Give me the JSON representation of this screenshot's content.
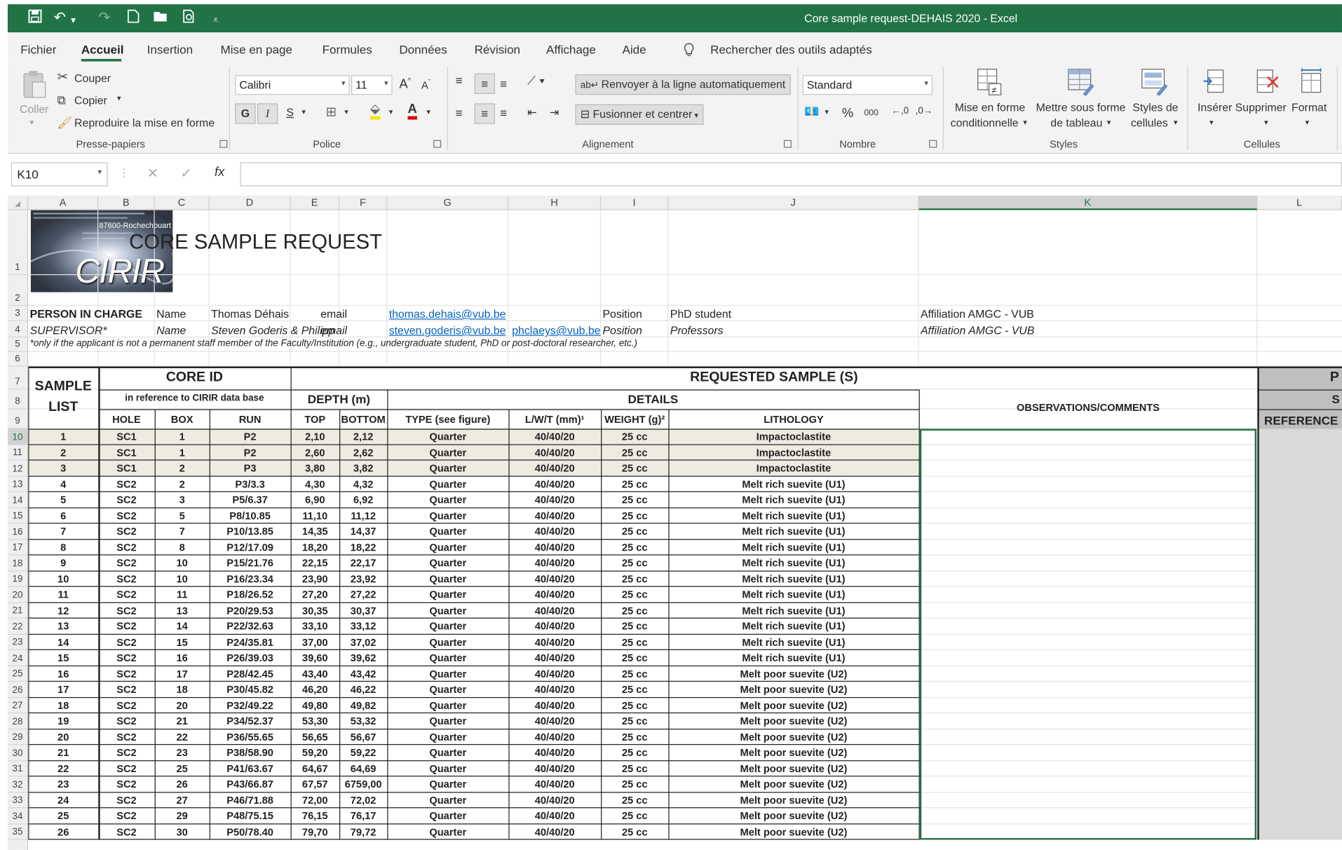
{
  "window": {
    "title": "Core sample request-DEHAIS 2020  -  Excel"
  },
  "quick_access": [
    "save-icon",
    "undo-icon",
    "redo-icon",
    "new-icon",
    "open-icon",
    "print-preview-icon",
    "customize-icon"
  ],
  "menu": [
    "Fichier",
    "Accueil",
    "Insertion",
    "Mise en page",
    "Formules",
    "Données",
    "Révision",
    "Affichage",
    "Aide"
  ],
  "tell_me": "Rechercher des outils adaptés",
  "ribbon": {
    "clipboard": {
      "paste": "Coller",
      "cut": "Couper",
      "copy": "Copier",
      "format_painter": "Reproduire la mise en forme",
      "group": "Presse-papiers"
    },
    "font": {
      "name": "Calibri",
      "size": "11",
      "bold": "G",
      "italic": "I",
      "underline": "S",
      "group": "Police"
    },
    "alignment": {
      "wrap": "Renvoyer à la ligne automatiquement",
      "merge": "Fusionner et centrer",
      "group": "Alignement"
    },
    "number": {
      "format": "Standard",
      "group": "Nombre",
      "percent": "%",
      "thousands": "000"
    },
    "styles": {
      "conditional_1": "Mise en forme",
      "conditional_2": "conditionnelle",
      "table_1": "Mettre sous forme",
      "table_2": "de tableau",
      "cell_1": "Styles de",
      "cell_2": "cellules",
      "group": "Styles"
    },
    "cells": {
      "insert": "Insérer",
      "delete": "Supprimer",
      "format": "Format",
      "group": "Cellules"
    }
  },
  "formula_bar": {
    "name_box": "K10",
    "formula": "",
    "fx": "fx"
  },
  "columns": [
    "A",
    "B",
    "C",
    "D",
    "E",
    "F",
    "G",
    "H",
    "I",
    "J",
    "K",
    "L"
  ],
  "rows": [
    "1",
    "2",
    "3",
    "4",
    "5",
    "6",
    "7",
    "8",
    "9",
    "10",
    "11",
    "12",
    "13",
    "14",
    "15",
    "16",
    "17",
    "18",
    "19",
    "20",
    "21",
    "22",
    "23",
    "24",
    "25",
    "26",
    "27",
    "28",
    "29",
    "30",
    "31",
    "32",
    "33",
    "34",
    "35"
  ],
  "logo": {
    "line1": "87600-Rochechouart",
    "text": "CIRIR"
  },
  "sheet": {
    "title": "CORE SAMPLE REQUEST",
    "person": {
      "label": "PERSON IN CHARGE",
      "name_label": "Name",
      "name": "Thomas Déhais",
      "email_label": "email",
      "email": "thomas.dehais@vub.be",
      "position_label": "Position",
      "position": "PhD student",
      "affiliation": "Affiliation AMGC - VUB"
    },
    "supervisor": {
      "label": "SUPERVISOR*",
      "name_label": "Name",
      "name": "Steven Goderis & Philipp",
      "email_label": "email",
      "email1": "steven.goderis@vub.be",
      "email2": "phclaeys@vub.be",
      "position_label": "Position",
      "position": "Professors",
      "affiliation": "Affiliation AMGC - VUB"
    },
    "footnote": "*only if the applicant is not a permanent staff member of the Faculty/Institution (e.g., undergraduate student, PhD or post-doctoral researcher, etc.)",
    "headers": {
      "sample_list_1": "SAMPLE",
      "sample_list_2": "LIST",
      "core_id": "CORE ID",
      "core_ref": "in reference to CIRIR data base",
      "requested": "REQUESTED SAMPLE (S)",
      "depth": "DEPTH (m)",
      "details": "DETAILS",
      "observations": "OBSERVATIONS/COMMENTS",
      "hole": "HOLE",
      "box": "BOX",
      "run": "RUN",
      "top": "TOP",
      "bottom": "BOTTOM",
      "type": "TYPE (see figure)",
      "lwt": "L/W/T (mm)¹",
      "weight": "WEIGHT (g)²",
      "lithology": "LITHOLOGY",
      "l_p": "P",
      "l_s": "S",
      "reference": "REFERENCE"
    },
    "samples": [
      [
        "1",
        "SC1",
        "1",
        "P2",
        "2,10",
        "2,12",
        "Quarter",
        "40/40/20",
        "25 cc",
        "Impactoclastite"
      ],
      [
        "2",
        "SC1",
        "1",
        "P2",
        "2,60",
        "2,62",
        "Quarter",
        "40/40/20",
        "25 cc",
        "Impactoclastite"
      ],
      [
        "3",
        "SC1",
        "2",
        "P3",
        "3,80",
        "3,82",
        "Quarter",
        "40/40/20",
        "25 cc",
        "Impactoclastite"
      ],
      [
        "4",
        "SC2",
        "2",
        "P3/3.3",
        "4,30",
        "4,32",
        "Quarter",
        "40/40/20",
        "25 cc",
        "Melt rich suevite (U1)"
      ],
      [
        "5",
        "SC2",
        "3",
        "P5/6.37",
        "6,90",
        "6,92",
        "Quarter",
        "40/40/20",
        "25 cc",
        "Melt rich suevite (U1)"
      ],
      [
        "6",
        "SC2",
        "5",
        "P8/10.85",
        "11,10",
        "11,12",
        "Quarter",
        "40/40/20",
        "25 cc",
        "Melt rich suevite (U1)"
      ],
      [
        "7",
        "SC2",
        "7",
        "P10/13.85",
        "14,35",
        "14,37",
        "Quarter",
        "40/40/20",
        "25 cc",
        "Melt rich suevite (U1)"
      ],
      [
        "8",
        "SC2",
        "8",
        "P12/17.09",
        "18,20",
        "18,22",
        "Quarter",
        "40/40/20",
        "25 cc",
        "Melt rich suevite (U1)"
      ],
      [
        "9",
        "SC2",
        "10",
        "P15/21.76",
        "22,15",
        "22,17",
        "Quarter",
        "40/40/20",
        "25 cc",
        "Melt rich suevite (U1)"
      ],
      [
        "10",
        "SC2",
        "10",
        "P16/23.34",
        "23,90",
        "23,92",
        "Quarter",
        "40/40/20",
        "25 cc",
        "Melt rich suevite (U1)"
      ],
      [
        "11",
        "SC2",
        "11",
        "P18/26.52",
        "27,20",
        "27,22",
        "Quarter",
        "40/40/20",
        "25 cc",
        "Melt rich suevite (U1)"
      ],
      [
        "12",
        "SC2",
        "13",
        "P20/29.53",
        "30,35",
        "30,37",
        "Quarter",
        "40/40/20",
        "25 cc",
        "Melt rich suevite (U1)"
      ],
      [
        "13",
        "SC2",
        "14",
        "P22/32.63",
        "33,10",
        "33,12",
        "Quarter",
        "40/40/20",
        "25 cc",
        "Melt rich suevite (U1)"
      ],
      [
        "14",
        "SC2",
        "15",
        "P24/35.81",
        "37,00",
        "37,02",
        "Quarter",
        "40/40/20",
        "25 cc",
        "Melt rich suevite (U1)"
      ],
      [
        "15",
        "SC2",
        "16",
        "P26/39.03",
        "39,60",
        "39,62",
        "Quarter",
        "40/40/20",
        "25 cc",
        "Melt rich suevite (U1)"
      ],
      [
        "16",
        "SC2",
        "17",
        "P28/42.45",
        "43,40",
        "43,42",
        "Quarter",
        "40/40/20",
        "25 cc",
        "Melt poor suevite (U2)"
      ],
      [
        "17",
        "SC2",
        "18",
        "P30/45.82",
        "46,20",
        "46,22",
        "Quarter",
        "40/40/20",
        "25 cc",
        "Melt poor suevite (U2)"
      ],
      [
        "18",
        "SC2",
        "20",
        "P32/49.22",
        "49,80",
        "49,82",
        "Quarter",
        "40/40/20",
        "25 cc",
        "Melt poor suevite (U2)"
      ],
      [
        "19",
        "SC2",
        "21",
        "P34/52.37",
        "53,30",
        "53,32",
        "Quarter",
        "40/40/20",
        "25 cc",
        "Melt poor suevite (U2)"
      ],
      [
        "20",
        "SC2",
        "22",
        "P36/55.65",
        "56,65",
        "56,67",
        "Quarter",
        "40/40/20",
        "25 cc",
        "Melt poor suevite (U2)"
      ],
      [
        "21",
        "SC2",
        "23",
        "P38/58.90",
        "59,20",
        "59,22",
        "Quarter",
        "40/40/20",
        "25 cc",
        "Melt poor suevite (U2)"
      ],
      [
        "22",
        "SC2",
        "25",
        "P41/63.67",
        "64,67",
        "64,69",
        "Quarter",
        "40/40/20",
        "25 cc",
        "Melt poor suevite (U2)"
      ],
      [
        "23",
        "SC2",
        "26",
        "P43/66.87",
        "67,57",
        "6759,00",
        "Quarter",
        "40/40/20",
        "25 cc",
        "Melt poor suevite (U2)"
      ],
      [
        "24",
        "SC2",
        "27",
        "P46/71.88",
        "72,00",
        "72,02",
        "Quarter",
        "40/40/20",
        "25 cc",
        "Melt poor suevite (U2)"
      ],
      [
        "25",
        "SC2",
        "29",
        "P48/75.15",
        "76,15",
        "76,17",
        "Quarter",
        "40/40/20",
        "25 cc",
        "Melt poor suevite (U2)"
      ],
      [
        "26",
        "SC2",
        "30",
        "P50/78.40",
        "79,70",
        "79,72",
        "Quarter",
        "40/40/20",
        "25 cc",
        "Melt poor suevite (U2)"
      ]
    ]
  },
  "colors": {
    "excel_green": "#217346",
    "highlight_row": "#eeece1",
    "hyperlink": "#0563c1",
    "selected_header": "#d2d2d2",
    "column_l_fill": "#d9d9d9"
  }
}
